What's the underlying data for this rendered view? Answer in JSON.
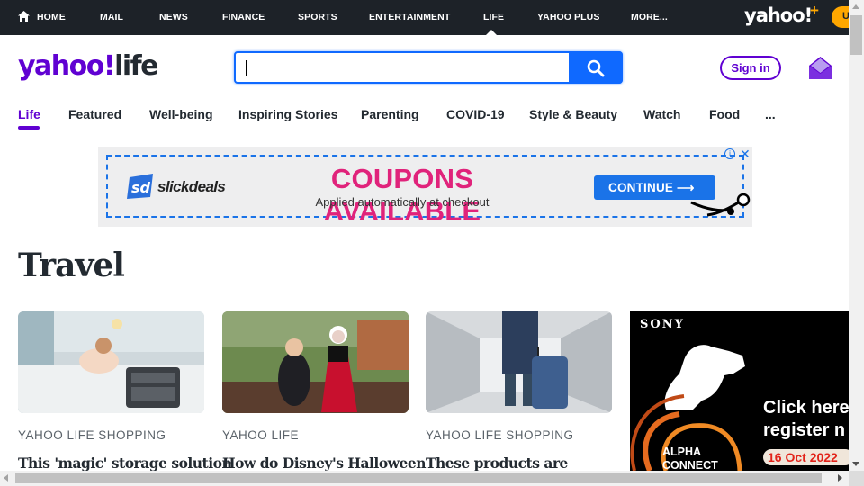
{
  "topnav": {
    "items": [
      "HOME",
      "MAIL",
      "NEWS",
      "FINANCE",
      "SPORTS",
      "ENTERTAINMENT",
      "LIFE",
      "YAHOO PLUS",
      "MORE..."
    ],
    "active": "LIFE",
    "logo": "yahoo!",
    "logo_plus": "+",
    "upgrade_label": "U"
  },
  "header": {
    "brand_yahoo": "yahoo!",
    "brand_life": "life",
    "search_value": "",
    "signin_label": "Sign in"
  },
  "subnav": {
    "tabs": [
      "Life",
      "Featured",
      "Well-being",
      "Inspiring Stories",
      "Parenting",
      "COVID-19",
      "Style & Beauty",
      "Watch",
      "Food",
      "..."
    ],
    "active": "Life"
  },
  "ad": {
    "brand": "slickdeals",
    "brand_mark": "sd",
    "headline": "COUPONS AVAILABLE",
    "subline": "Applied automatically at checkout",
    "cta": "CONTINUE ⟶",
    "adchoices": "i",
    "close": "✕"
  },
  "section": {
    "title": "Travel"
  },
  "cards": [
    {
      "source": "YAHOO LIFE SHOPPING",
      "headline": "This 'magic' storage solution"
    },
    {
      "source": "YAHOO LIFE",
      "headline": "How do Disney's Halloween"
    },
    {
      "source": "YAHOO LIFE SHOPPING",
      "headline": "These products are"
    }
  ],
  "sony_ad": {
    "logo": "SONY",
    "cta_line1": "Click here",
    "cta_line2": "register n",
    "date": "16 Oct 2022",
    "alpha_line1": "ALPHA",
    "alpha_line2": "CONNECT"
  },
  "colors": {
    "brand_purple": "#6001d2",
    "search_blue": "#0f69ff",
    "ad_pink": "#e0237b",
    "topbar_bg": "#1d2228",
    "accent_orange": "#ffa700"
  }
}
